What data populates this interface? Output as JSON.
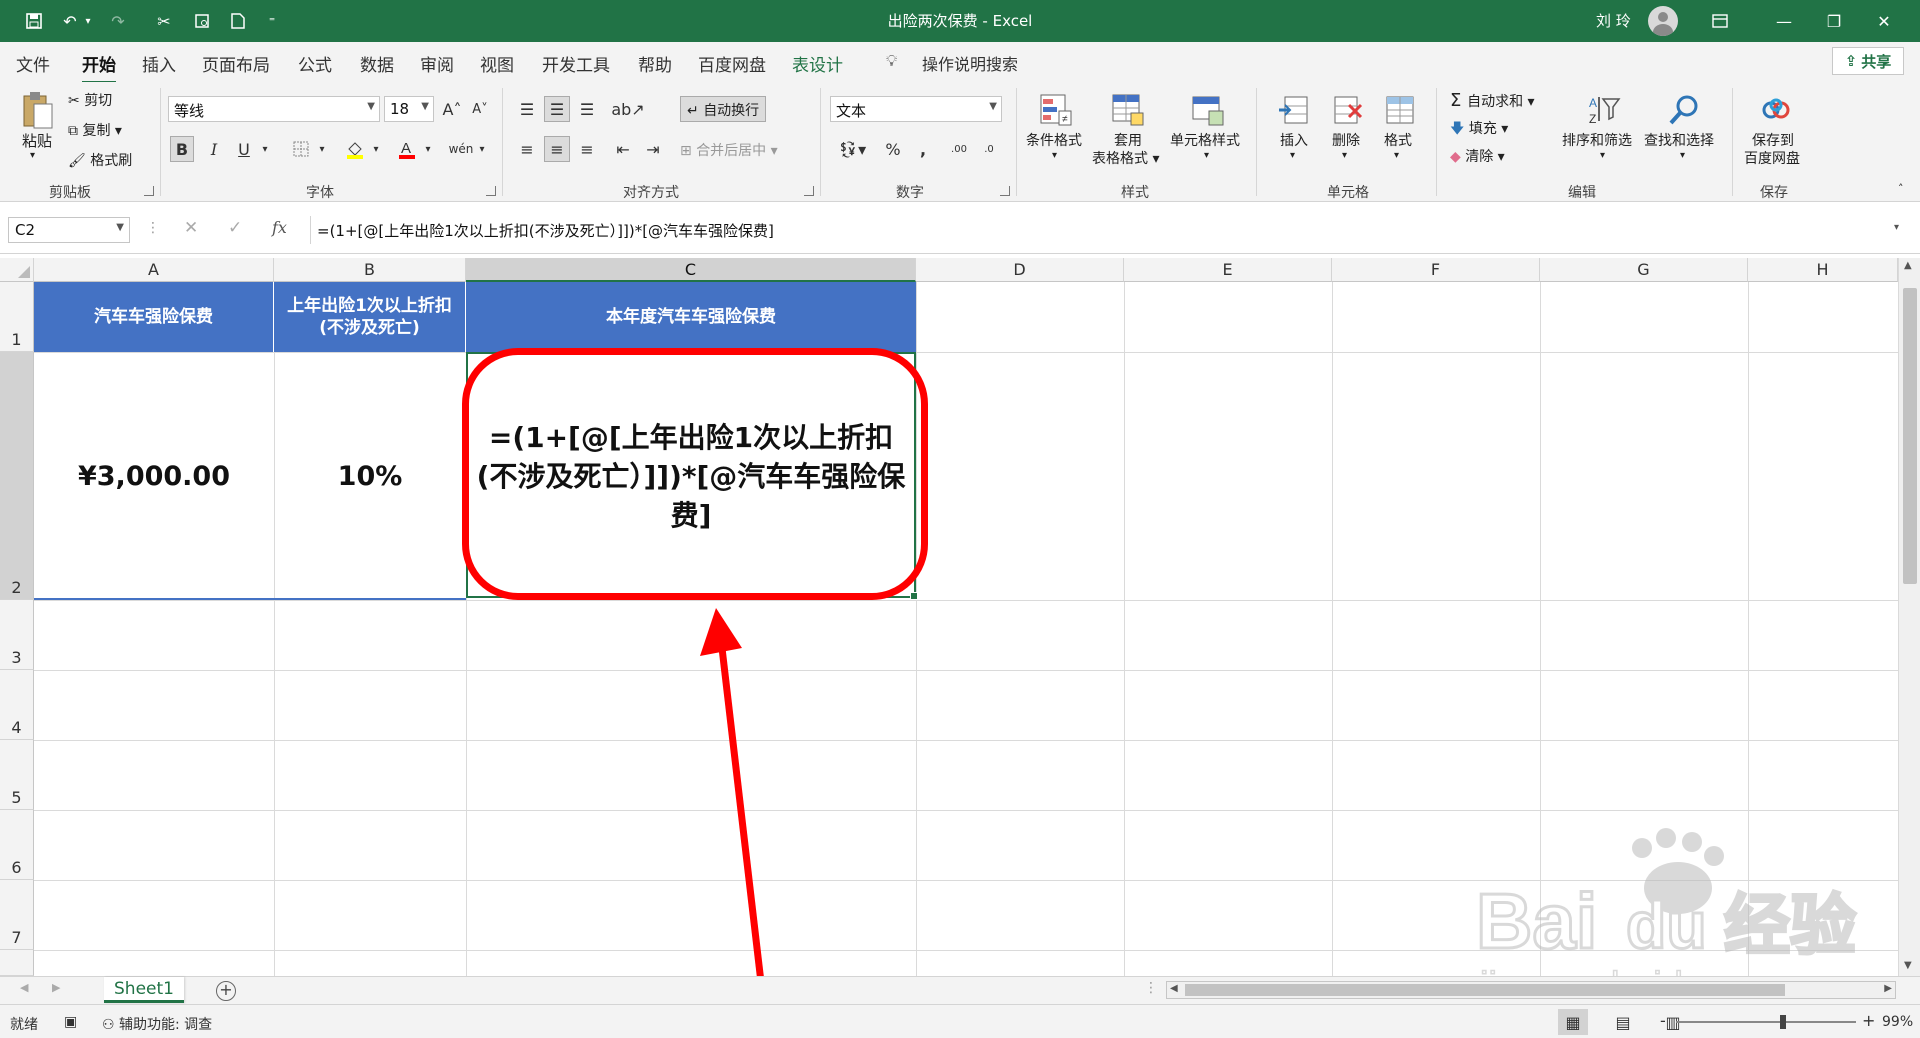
{
  "window": {
    "title": "出险两次保费 - Excel",
    "user": "刘 玲"
  },
  "ribbon_tabs": [
    "文件",
    "开始",
    "插入",
    "页面布局",
    "公式",
    "数据",
    "审阅",
    "视图",
    "开发工具",
    "帮助",
    "百度网盘",
    "表设计"
  ],
  "tell_me": "操作说明搜索",
  "share": "共享",
  "clipboard": {
    "paste": "粘贴",
    "cut": "剪切",
    "copy": "复制",
    "format_painter": "格式刷",
    "label": "剪贴板"
  },
  "font": {
    "name": "等线",
    "size": "18",
    "bold": "B",
    "italic": "I",
    "underline": "U",
    "label": "字体"
  },
  "alignment": {
    "wrap_text": "自动换行",
    "merge_center": "合并后居中",
    "label": "对齐方式"
  },
  "number": {
    "format": "文本",
    "label": "数字"
  },
  "styles": {
    "conditional": "条件格式",
    "table_format_1": "套用",
    "table_format_2": "表格格式",
    "cell_styles": "单元格样式",
    "label": "样式"
  },
  "cells": {
    "insert": "插入",
    "delete": "删除",
    "format": "格式",
    "label": "单元格"
  },
  "editing": {
    "autosum": "自动求和",
    "fill": "填充",
    "clear": "清除",
    "sort_filter": "排序和筛选",
    "find_select": "查找和选择",
    "label": "编辑"
  },
  "save_group": {
    "save_to_1": "保存到",
    "save_to_2": "百度网盘",
    "label": "保存"
  },
  "formula_bar": {
    "name_box": "C2",
    "fx": "fx",
    "formula": "=(1+[@[上年出险1次以上折扣(不涉及死亡）]])*[@汽车车强险保费]"
  },
  "columns": [
    "A",
    "B",
    "C",
    "D",
    "E",
    "F",
    "G",
    "H"
  ],
  "rows": [
    "1",
    "2",
    "3",
    "4",
    "5",
    "6",
    "7"
  ],
  "table": {
    "headers": [
      "汽车车强险保费",
      "上年出险1次以上折扣(不涉及死亡)",
      "本年度汽车车强险保费"
    ],
    "row2": [
      "¥3,000.00",
      "10%",
      "=(1+[@[上年出险1次以上折扣(不涉及死亡）]])*[@汽车车强险保费]"
    ]
  },
  "sheets": [
    "Sheet1"
  ],
  "status": {
    "ready": "就绪",
    "accessibility": "辅助功能: 调查",
    "zoom": "99%",
    "minus": "-",
    "plus": "+"
  },
  "watermark": {
    "text_1": "Bai",
    "text_2": "du",
    "text_3": "经验",
    "url": "jingyan.baidu.com"
  },
  "colors": {
    "excel_green": "#217346",
    "table_header_blue": "#4472c4",
    "annotation_red": "#ff0000"
  }
}
